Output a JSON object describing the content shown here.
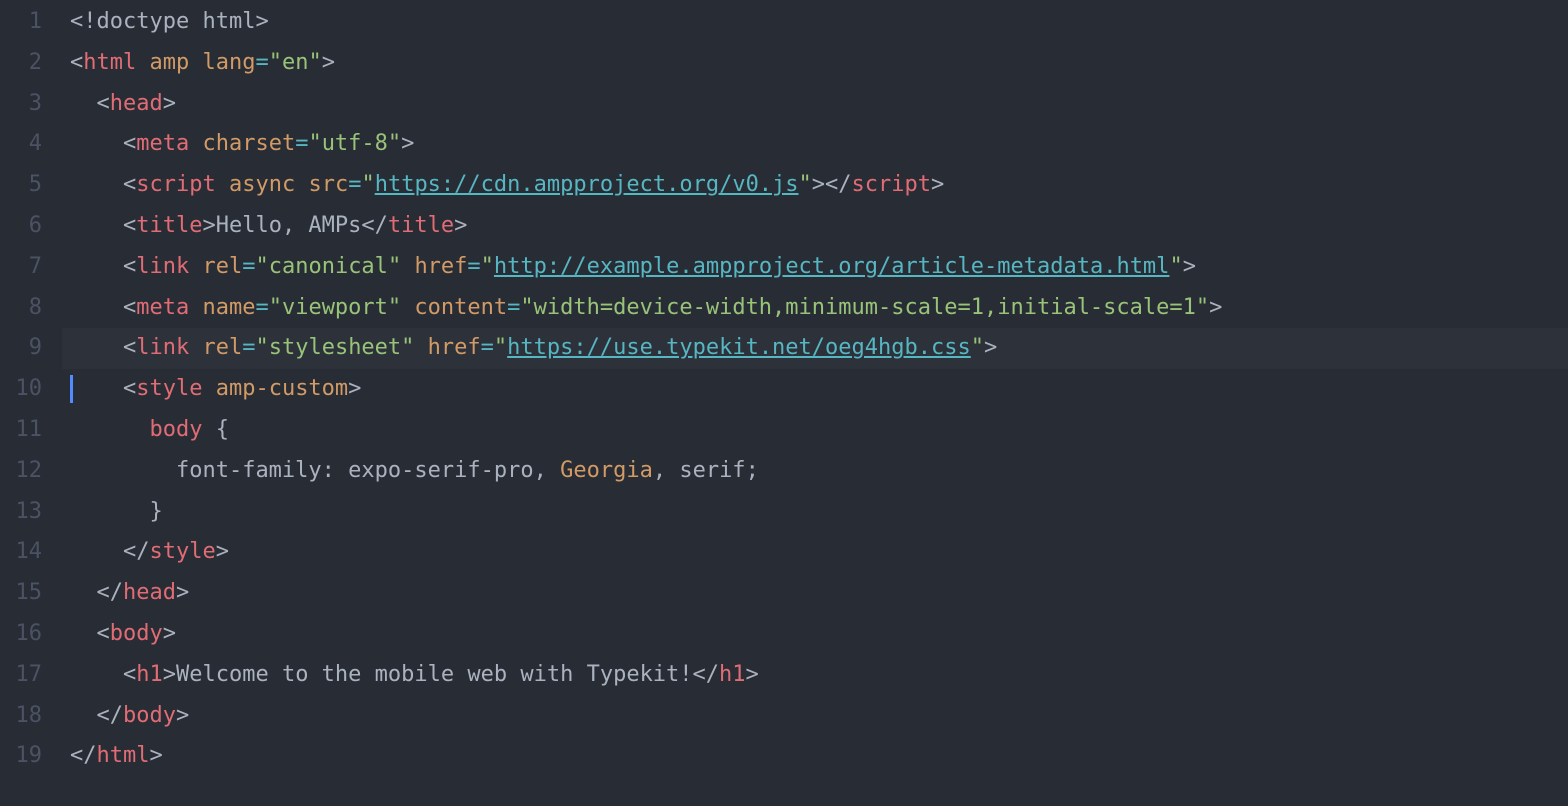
{
  "gutter": [
    "1",
    "2",
    "3",
    "4",
    "5",
    "6",
    "7",
    "8",
    "9",
    "10",
    "11",
    "12",
    "13",
    "14",
    "15",
    "16",
    "17",
    "18",
    "19"
  ],
  "code": {
    "l1": {
      "p1": "<!",
      "kw": "doctype html",
      "p2": ">"
    },
    "l2": {
      "p1": "<",
      "tag": "html",
      "sp": " ",
      "a1": "amp",
      "sp2": " ",
      "a2": "lang",
      "eq": "=",
      "q1": "\"",
      "v": "en",
      "q2": "\"",
      "p2": ">"
    },
    "l3": {
      "p1": "<",
      "tag": "head",
      "p2": ">"
    },
    "l4": {
      "p1": "<",
      "tag": "meta",
      "sp": " ",
      "a1": "charset",
      "eq": "=",
      "q1": "\"",
      "v": "utf-8",
      "q2": "\"",
      "p2": ">"
    },
    "l5": {
      "p1": "<",
      "tag": "script",
      "sp": " ",
      "a1": "async",
      "sp2": " ",
      "a2": "src",
      "eq": "=",
      "q1": "\"",
      "url": "https://cdn.ampproject.org/v0.js",
      "q2": "\"",
      "p2": ">",
      "p3": "</",
      "tag2": "script",
      "p4": ">"
    },
    "l6": {
      "p1": "<",
      "tag": "title",
      "p2": ">",
      "txt": "Hello, AMPs",
      "p3": "</",
      "tag2": "title",
      "p4": ">"
    },
    "l7": {
      "p1": "<",
      "tag": "link",
      "sp": " ",
      "a1": "rel",
      "eq": "=",
      "q1": "\"",
      "v1": "canonical",
      "q2": "\"",
      "sp2": " ",
      "a2": "href",
      "eq2": "=",
      "q3": "\"",
      "url": "http://example.ampproject.org/article-metadata.html",
      "q4": "\"",
      "p2": ">"
    },
    "l8": {
      "p1": "<",
      "tag": "meta",
      "sp": " ",
      "a1": "name",
      "eq": "=",
      "q1": "\"",
      "v1": "viewport",
      "q2": "\"",
      "sp2": " ",
      "a2": "content",
      "eq2": "=",
      "q3": "\"",
      "v2": "width=device-width,minimum-scale=1,initial-scale=1",
      "q4": "\"",
      "p2": ">"
    },
    "l9": {
      "p1": "<",
      "tag": "link",
      "sp": " ",
      "a1": "rel",
      "eq": "=",
      "q1": "\"",
      "v1": "stylesheet",
      "q2": "\"",
      "sp2": " ",
      "a2": "href",
      "eq2": "=",
      "q3": "\"",
      "url": "https://use.typekit.net/oeg4hgb.css",
      "q4": "\"",
      "p2": ">"
    },
    "l10": {
      "p1": "<",
      "tag": "style",
      "sp": " ",
      "a1": "amp-custom",
      "p2": ">"
    },
    "l11": {
      "sel": "body",
      "sp": " ",
      "br": "{"
    },
    "l12": {
      "prop": "font-family",
      "col": ":",
      "sp": " ",
      "v1": "expo-serif-pro",
      "c1": ",",
      "sp2": " ",
      "v2": "Georgia",
      "c2": ",",
      "sp3": " ",
      "v3": "serif",
      "sc": ";"
    },
    "l13": {
      "br": "}"
    },
    "l14": {
      "p1": "</",
      "tag": "style",
      "p2": ">"
    },
    "l15": {
      "p1": "</",
      "tag": "head",
      "p2": ">"
    },
    "l16": {
      "p1": "<",
      "tag": "body",
      "p2": ">"
    },
    "l17": {
      "p1": "<",
      "tag": "h1",
      "p2": ">",
      "txt": "Welcome to the mobile web with Typekit!",
      "p3": "</",
      "tag2": "h1",
      "p4": ">"
    },
    "l18": {
      "p1": "</",
      "tag": "body",
      "p2": ">"
    },
    "l19": {
      "p1": "</",
      "tag": "html",
      "p2": ">"
    }
  },
  "indents": {
    "i0": "",
    "i1": "  ",
    "i2": "    ",
    "i3": "      ",
    "i4": "        "
  }
}
